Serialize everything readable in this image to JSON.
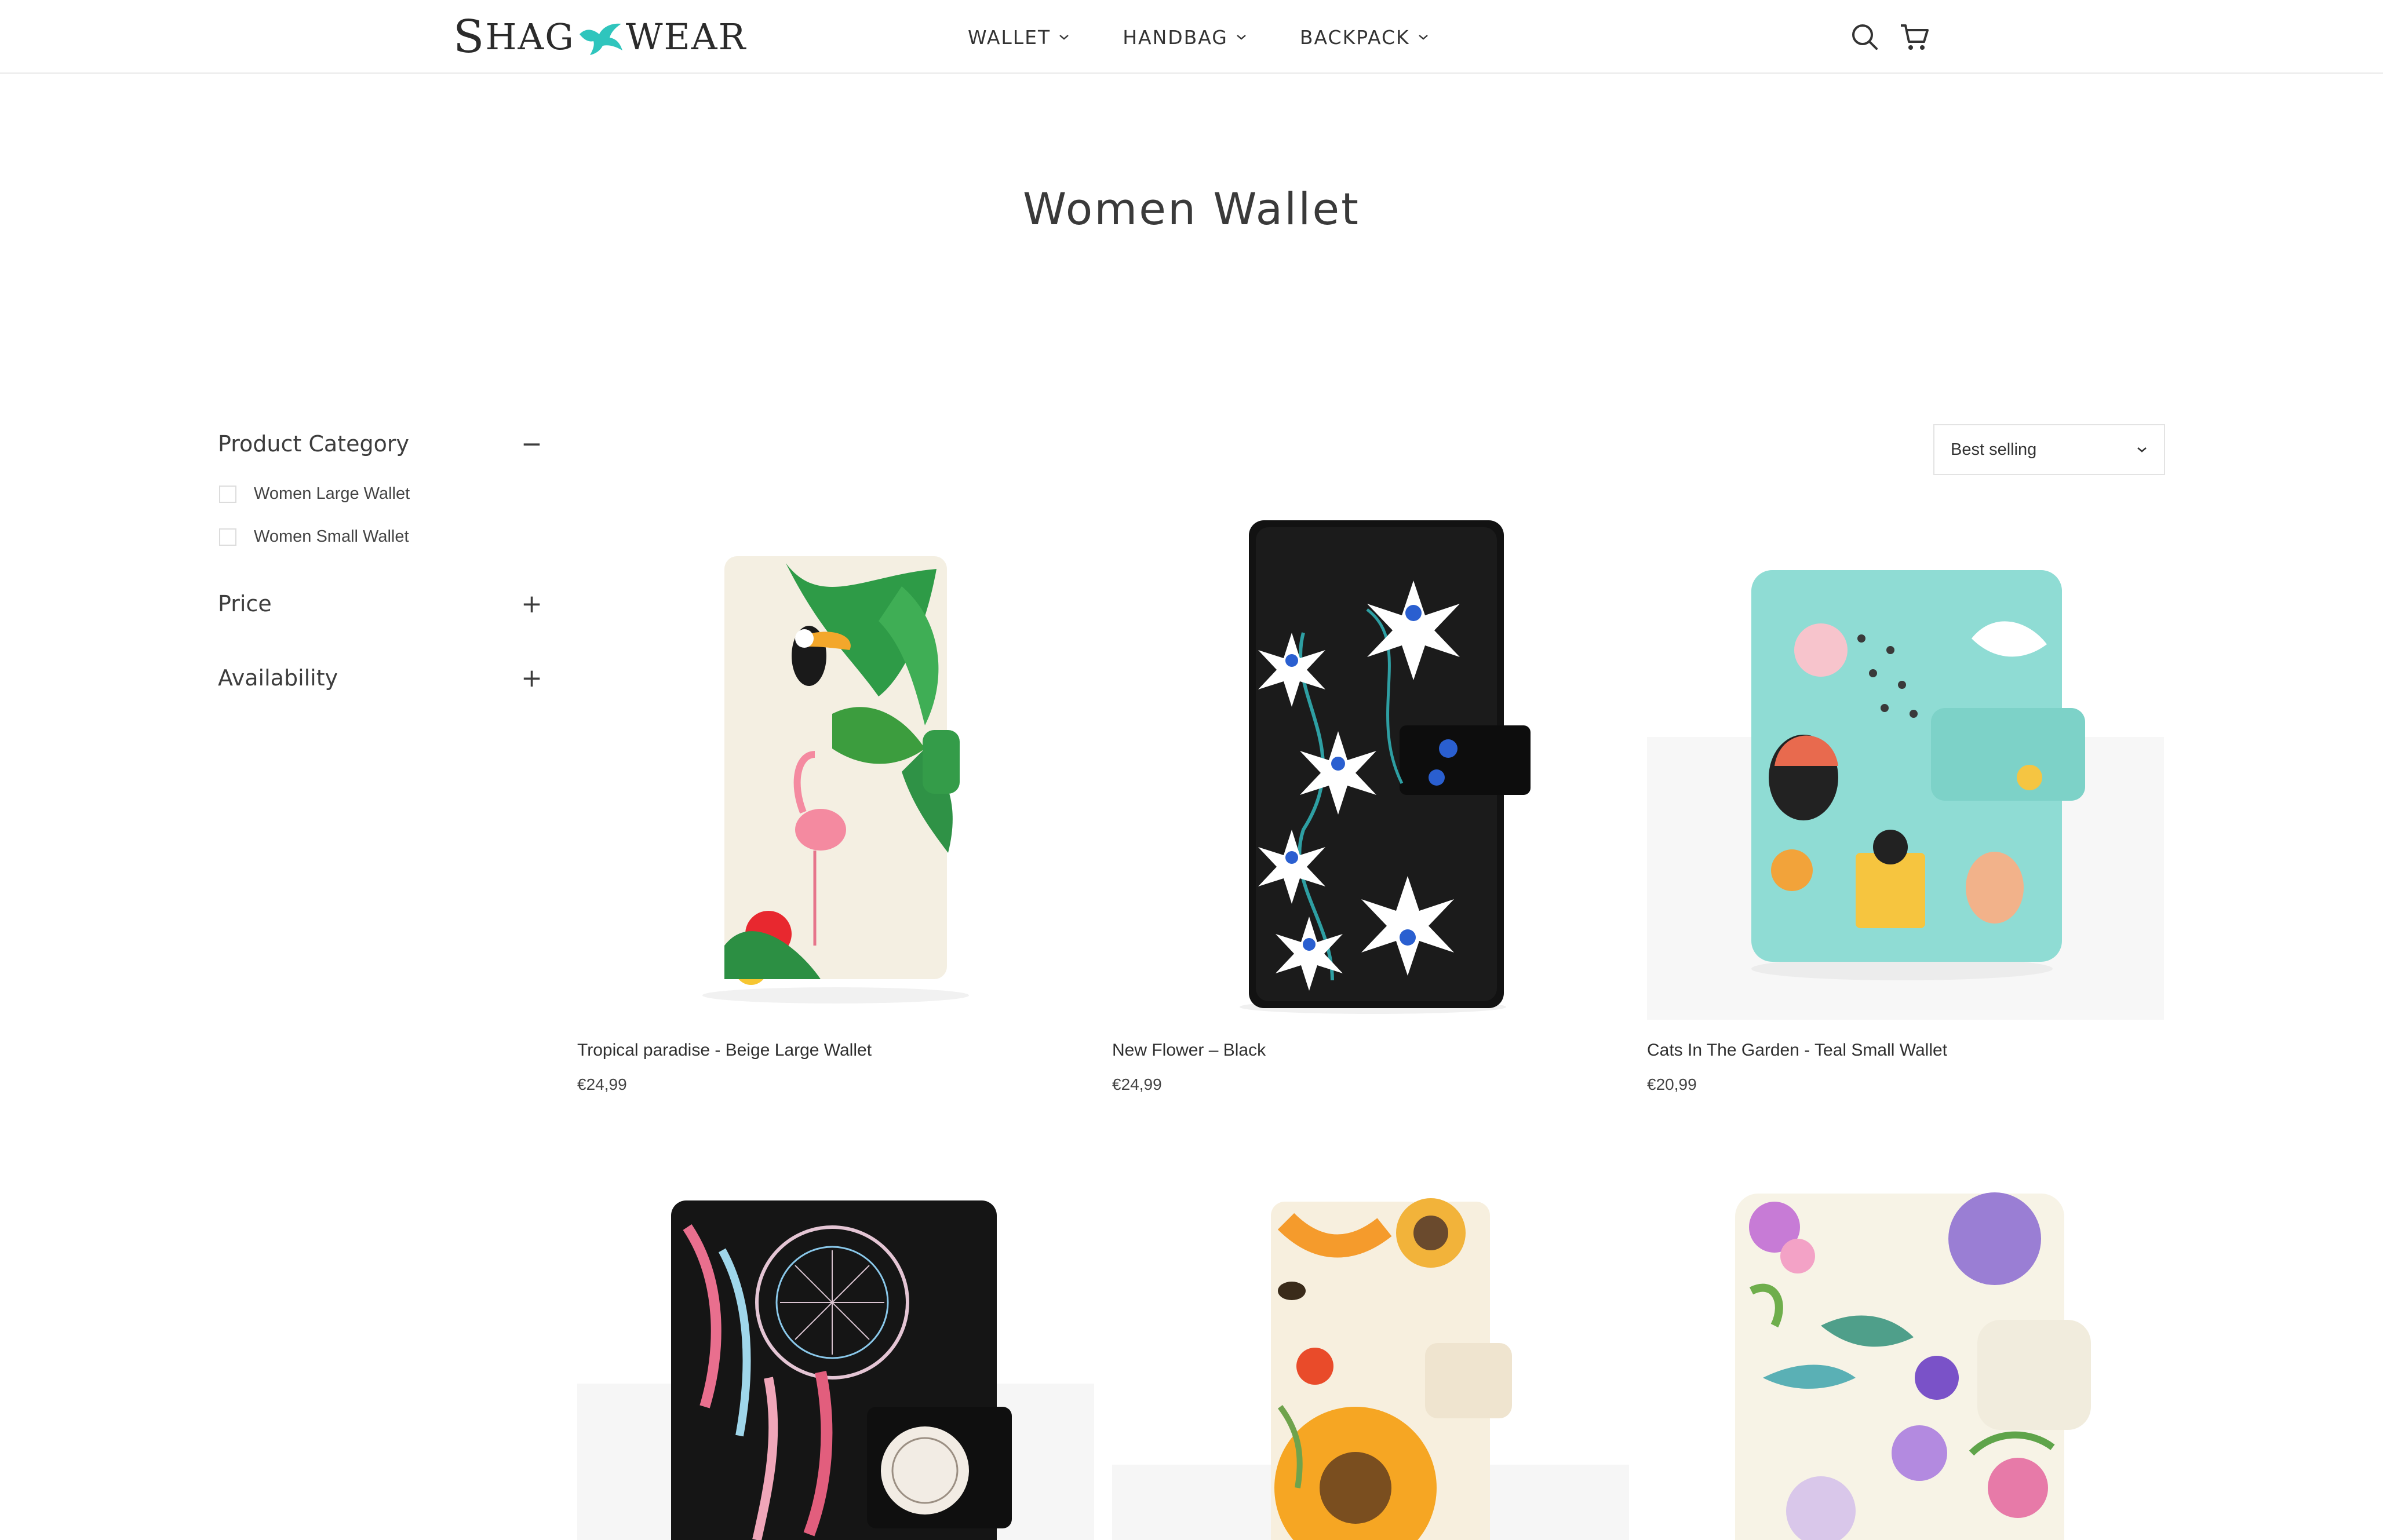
{
  "brand": {
    "part1": "S",
    "part2": "HAG",
    "part3": "WEAR"
  },
  "nav": [
    {
      "label": "WALLET"
    },
    {
      "label": "HANDBAG"
    },
    {
      "label": "BACKPACK"
    }
  ],
  "header_icons": [
    "search-icon",
    "cart-icon"
  ],
  "page_title": "Women Wallet",
  "filters": {
    "category": {
      "title": "Product Category",
      "toggle": "−",
      "options": [
        {
          "label": "Women Large Wallet",
          "checked": false
        },
        {
          "label": "Women Small Wallet",
          "checked": false
        }
      ]
    },
    "price": {
      "title": "Price",
      "toggle": "+"
    },
    "availability": {
      "title": "Availability",
      "toggle": "+"
    }
  },
  "sort": {
    "selected": "Best selling"
  },
  "products": [
    {
      "name": "Tropical paradise - Beige Large Wallet",
      "price": "€24,99"
    },
    {
      "name": "New Flower – Black",
      "price": "€24,99"
    },
    {
      "name": "Cats In The Garden - Teal Small Wallet",
      "price": "€20,99"
    },
    {
      "name": "",
      "price": ""
    },
    {
      "name": "",
      "price": ""
    },
    {
      "name": "",
      "price": ""
    }
  ],
  "colors": {
    "logo_accent": "#2fc5bd",
    "text": "#333333",
    "border": "#e3e3e3"
  }
}
